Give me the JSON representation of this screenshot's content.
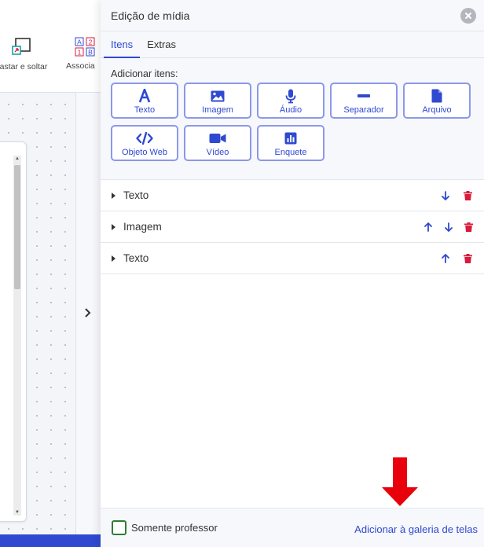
{
  "background": {
    "toolbar": {
      "drag_label": "astar e soltar",
      "assoc_label": "Associa",
      "assoc_glyphs": [
        "A",
        "2",
        "1",
        "B"
      ]
    }
  },
  "panel": {
    "title": "Edição de mídia",
    "tabs": [
      {
        "label": "Itens",
        "active": true
      },
      {
        "label": "Extras",
        "active": false
      }
    ],
    "add_label": "Adicionar itens:",
    "add_buttons": [
      {
        "label": "Texto",
        "icon": "text-icon"
      },
      {
        "label": "Imagem",
        "icon": "image-icon"
      },
      {
        "label": "Áudio",
        "icon": "microphone-icon"
      },
      {
        "label": "Separador",
        "icon": "separator-icon"
      },
      {
        "label": "Arquivo",
        "icon": "file-icon"
      },
      {
        "label": "Objeto Web",
        "icon": "code-icon"
      },
      {
        "label": "Vídeo",
        "icon": "video-icon"
      },
      {
        "label": "Enquete",
        "icon": "poll-icon"
      }
    ],
    "items": [
      {
        "label": "Texto",
        "up": false,
        "down": true
      },
      {
        "label": "Imagem",
        "up": true,
        "down": true
      },
      {
        "label": "Texto",
        "up": true,
        "down": false
      }
    ],
    "footer": {
      "checkbox_label": "Somente professor",
      "checkbox_checked": false,
      "gallery_link": "Adicionar à galeria de telas"
    }
  },
  "colors": {
    "accent": "#2f49d1",
    "button_border": "#8c98e8",
    "delete": "#d81b3c",
    "checkbox_border": "#2e7d32",
    "annotation_arrow": "#e8000b"
  }
}
